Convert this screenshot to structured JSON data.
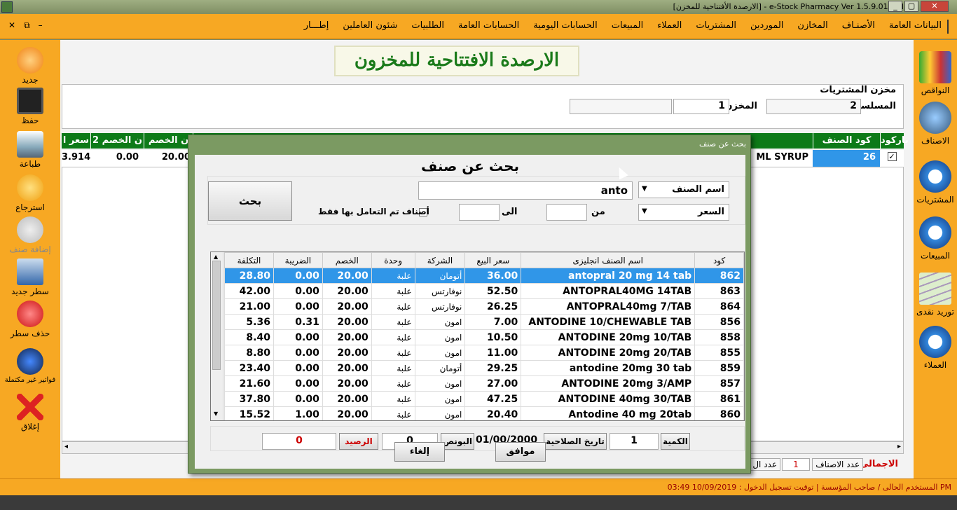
{
  "window": {
    "title": "[الارصدة الأفتتاحية للمخزن] - e-Stock Pharmacy Ver 1.5.9.01 Full",
    "min": "_",
    "max": "▢",
    "close": "✕"
  },
  "menu": {
    "items": [
      "البيانات العامة",
      "الأصنـاف",
      "المخازن",
      "الموردين",
      "المشتريات",
      "العملاء",
      "المبيعات",
      "الحسابات اليومية",
      "الحسابات العامة",
      "الطلبيات",
      "شئون العاملين",
      "إطـــار"
    ],
    "mdi_close": "✕",
    "mdi_restore": "⧉",
    "mdi_min": "–"
  },
  "left_toolbar": [
    "جديد",
    "حفظ",
    "طباعة",
    "استرجاع",
    "إضافة صنف",
    "سطر جديد",
    "حذف سطر",
    "فواتير غير مكتملة",
    "إغلاق"
  ],
  "right_toolbar": [
    "النواقص",
    "الاصناف",
    "المشتريات",
    "المبيعات",
    "توريد نقدى",
    "العملاء"
  ],
  "form": {
    "title": "الارصدة الافتتاحية للمخزون",
    "store_name": "مخزن المشتريات",
    "serial_label": "المسلسل",
    "serial_value": "2",
    "store_label": "المخزن",
    "store_value": "1"
  },
  "grid": {
    "headers": [
      "باركود",
      "كود الصنف",
      "ن الخصم",
      "ن الخصم 2",
      "سعر ا"
    ],
    "row": {
      "checked": true,
      "code": "26",
      "name_fragment": "ML SYRUP",
      "discount": "20.00",
      "discount2": "0.00",
      "price": "3.914"
    }
  },
  "totals": {
    "total_label": "الاجمالى",
    "items_count_label": "عدد الاصناف",
    "items_count": "1",
    "count_label": "عدد ال"
  },
  "status": {
    "text": "المستخدم الحالى /  صاحب المؤسسة  |  توقيت تسجيل الدخول :  10/09/2019  03:49 PM"
  },
  "dialog": {
    "title": "بحث عن صنف",
    "heading": "بحث عن صنف",
    "search_field": "اسم الصنف",
    "search_value": "anto",
    "price_field": "السعر",
    "from_label": "من",
    "to_label": "الى",
    "only_traded_label": "أصناف تم التعامل بها فقط",
    "search_button": "بحث",
    "columns": [
      "كود",
      "اسم الصنف انجليزى",
      "سعر البيع",
      "الشركة",
      "وحدة",
      "الخصم",
      "الضريبة",
      "التكلفة"
    ],
    "rows": [
      {
        "code": "862",
        "name": "antopral 20 mg 14 tab",
        "price": "36.00",
        "company": "أتومان",
        "unit": "علبة",
        "discount": "20.00",
        "tax": "0.00",
        "cost": "28.80"
      },
      {
        "code": "863",
        "name": "ANTOPRAL40MG 14TAB",
        "price": "52.50",
        "company": "نوفارتس",
        "unit": "علبة",
        "discount": "20.00",
        "tax": "0.00",
        "cost": "42.00"
      },
      {
        "code": "864",
        "name": "ANTOPRAL40mg 7/TAB",
        "price": "26.25",
        "company": "نوفارتس",
        "unit": "علبة",
        "discount": "20.00",
        "tax": "0.00",
        "cost": "21.00"
      },
      {
        "code": "856",
        "name": "ANTODINE 10/CHEWABLE TAB",
        "price": "7.00",
        "company": "امون",
        "unit": "علبة",
        "discount": "20.00",
        "tax": "0.31",
        "cost": "5.36"
      },
      {
        "code": "858",
        "name": "ANTODINE 20mg 10/TAB",
        "price": "10.50",
        "company": "امون",
        "unit": "علبة",
        "discount": "20.00",
        "tax": "0.00",
        "cost": "8.40"
      },
      {
        "code": "855",
        "name": "ANTODINE  20mg  20/TAB",
        "price": "11.00",
        "company": "امون",
        "unit": "علبة",
        "discount": "20.00",
        "tax": "0.00",
        "cost": "8.80"
      },
      {
        "code": "859",
        "name": "antodine 20mg 30 tab",
        "price": "29.25",
        "company": "أتومان",
        "unit": "علبة",
        "discount": "20.00",
        "tax": "0.00",
        "cost": "23.40"
      },
      {
        "code": "857",
        "name": "ANTODINE 20mg  3/AMP",
        "price": "27.00",
        "company": "امون",
        "unit": "علبة",
        "discount": "20.00",
        "tax": "0.00",
        "cost": "21.60"
      },
      {
        "code": "861",
        "name": "ANTODINE 40mg 30/TAB",
        "price": "47.25",
        "company": "امون",
        "unit": "علبة",
        "discount": "20.00",
        "tax": "0.00",
        "cost": "37.80"
      },
      {
        "code": "860",
        "name": "Antodine 40 mg 20tab",
        "price": "20.40",
        "company": "امون",
        "unit": "علبة",
        "discount": "20.00",
        "tax": "1.00",
        "cost": "15.52"
      }
    ],
    "qty_label": "الكمية",
    "qty_value": "1",
    "expiry_label": "تاريخ الصلاحية",
    "expiry_value": "01/00/2000",
    "bonus_label": "البونص",
    "bonus_value": "0",
    "balance_label": "الرصيد",
    "balance_value": "0",
    "ok_button": "موافق",
    "cancel_button": "إلغاء"
  }
}
